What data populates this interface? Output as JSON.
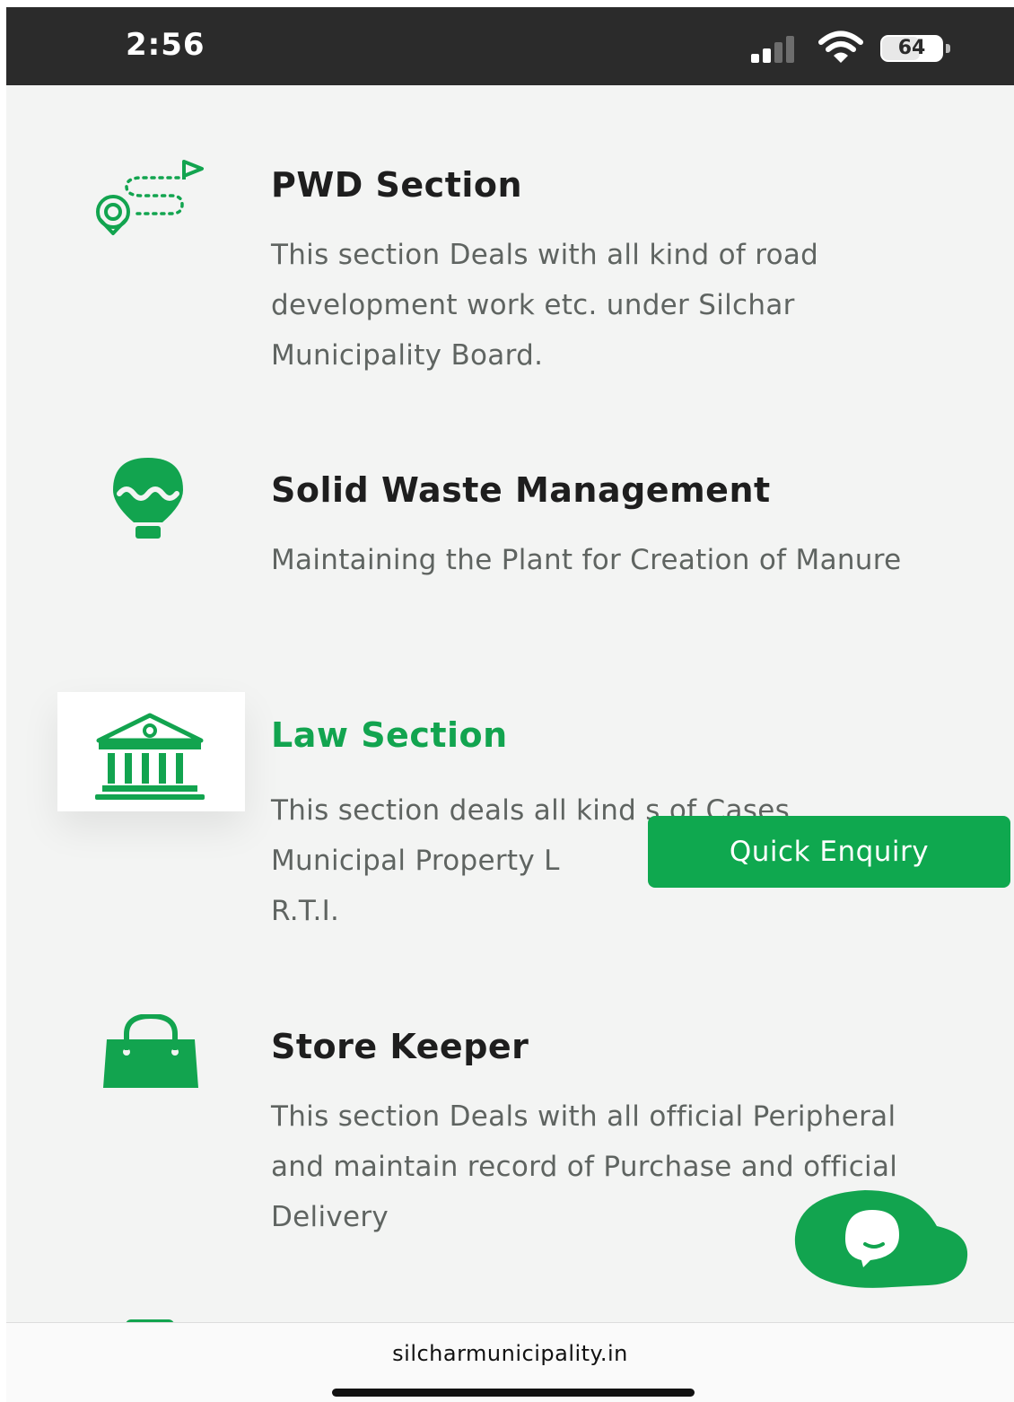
{
  "status_bar": {
    "time": "2:56",
    "battery": "64",
    "battery_level": 0.64,
    "icons": [
      "signal-icon",
      "wifi-icon",
      "battery-icon"
    ]
  },
  "sections": [
    {
      "title": "PWD Section",
      "description": "This section Deals with all kind of road development work etc. under Silchar Municipality Board.",
      "icon": "route-map-icon"
    },
    {
      "title": "Solid Waste Management",
      "description": "Maintaining the Plant for Creation of Manure",
      "icon": "hot-air-balloon-icon"
    },
    {
      "title": "Law Section",
      "description": "This section deals all kind s of Cases Municipal Property L... R.T.I.",
      "description_lines": [
        "This section deals all kind s of Cases",
        "Municipal Property L",
        "R.T.I."
      ],
      "icon": "courthouse-icon"
    },
    {
      "title": "Store Keeper",
      "description": "This section Deals with all official Peripheral and maintain record of Purchase and official Delivery",
      "icon": "shopping-bag-icon"
    }
  ],
  "quick_enquiry": {
    "label": "Quick Enquiry"
  },
  "chat": {
    "icon": "chat-bubble-icon"
  },
  "browser": {
    "url": "silcharmunicipality.in"
  },
  "colors": {
    "accent": "#12a44f",
    "button": "#0fa84f",
    "status_bar": "#2b2b2b",
    "background": "#f3f4f3",
    "title": "#1e1e1e",
    "text": "#5f6461"
  }
}
